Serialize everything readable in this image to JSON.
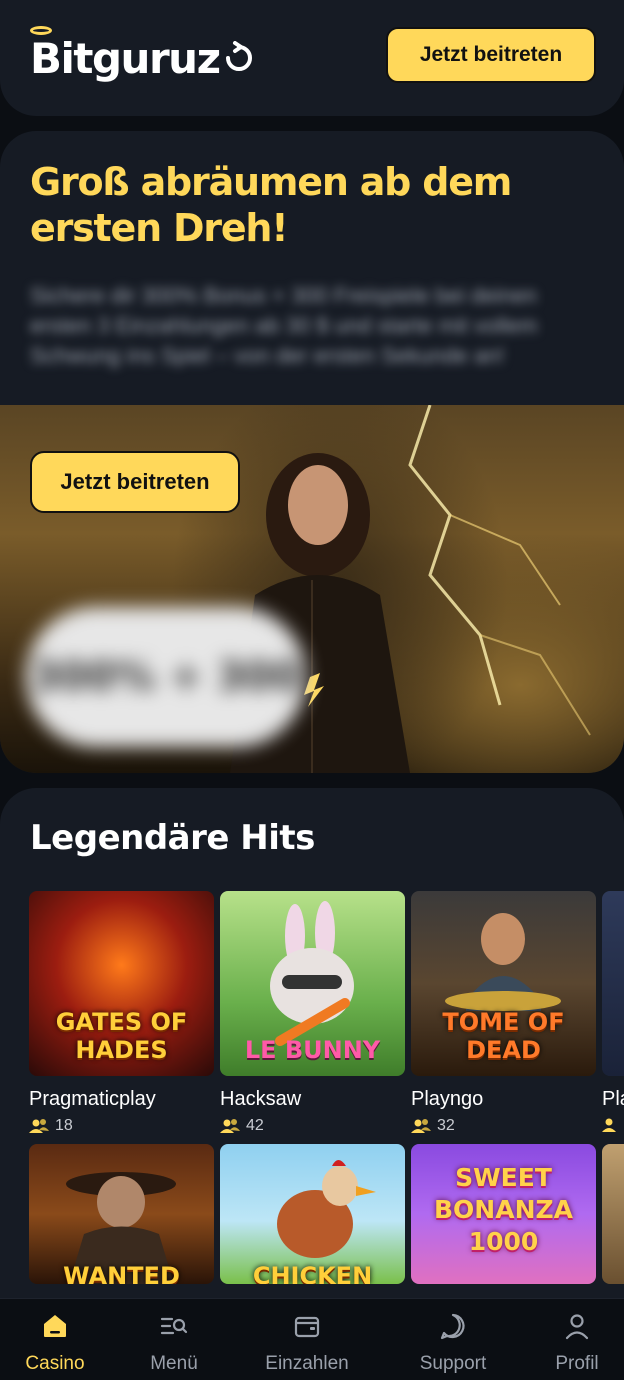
{
  "header": {
    "logo_text": "Bitguruz",
    "join_label": "Jetzt beitreten"
  },
  "hero": {
    "title": "Groß abräumen ab dem ersten Dreh!",
    "description": "Sichere dir 300% Bonus + 300 Freispiele bei deinen ersten 3 Einzahlungen ab 30 $ und starte mit vollem Schwung ins Spiel – von der ersten Sekunde an!",
    "join_label": "Jetzt beitreten",
    "badge_text": "300% + 300"
  },
  "hits": {
    "title": "Legendäre Hits",
    "row1": [
      {
        "provider": "Pragmaticplay",
        "players": "18",
        "game": "GATES OF HADES"
      },
      {
        "provider": "Hacksaw",
        "players": "42",
        "game": "LE BUNNY"
      },
      {
        "provider": "Playngo",
        "players": "32",
        "game": "TOME OF DEAD"
      },
      {
        "provider": "Pla",
        "players": "",
        "game": ""
      }
    ],
    "row2": [
      {
        "game": "WANTED"
      },
      {
        "game": "CHICKEN"
      },
      {
        "game": "SWEET BONANZA 1000"
      },
      {
        "game": ""
      }
    ]
  },
  "nav": {
    "items": [
      {
        "label": "Casino",
        "icon": "home-icon"
      },
      {
        "label": "Menü",
        "icon": "menu-search-icon"
      },
      {
        "label": "Einzahlen",
        "icon": "wallet-icon"
      },
      {
        "label": "Support",
        "icon": "chat-icon"
      },
      {
        "label": "Profil",
        "icon": "user-icon"
      }
    ]
  },
  "colors": {
    "accent": "#ffd85a",
    "background": "#0b0e13",
    "panel": "#161b24"
  }
}
